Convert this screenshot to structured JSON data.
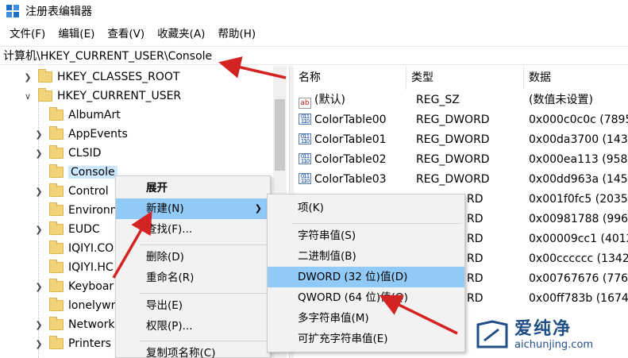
{
  "window": {
    "title": "注册表编辑器"
  },
  "menu": [
    "文件(F)",
    "编辑(E)",
    "查看(V)",
    "收藏夹(A)",
    "帮助(H)"
  ],
  "address": "计算机\\HKEY_CURRENT_USER\\Console",
  "tree": {
    "roots": [
      "HKEY_CLASSES_ROOT",
      "HKEY_CURRENT_USER"
    ],
    "children": [
      "AlbumArt",
      "AppEvents",
      "CLSID",
      "Console",
      "Control",
      "Environm",
      "EUDC",
      "IQIYI.CO",
      "IQIYI.HC",
      "Keyboar",
      "lonelywr",
      "Network",
      "Printers"
    ],
    "selected": "Console"
  },
  "list": {
    "columns": [
      "名称",
      "类型",
      "数据"
    ],
    "rows": [
      {
        "name": "(默认)",
        "type": "REG_SZ",
        "data": "(数值未设置)",
        "icon": "string-value-icon"
      },
      {
        "name": "ColorTable00",
        "type": "REG_DWORD",
        "data": "0x000c0c0c (7895",
        "icon": "binary-value-icon"
      },
      {
        "name": "ColorTable01",
        "type": "REG_DWORD",
        "data": "0x00da3700 (143",
        "icon": "binary-value-icon"
      },
      {
        "name": "ColorTable02",
        "type": "REG_DWORD",
        "data": "0x000ea113 (958",
        "icon": "binary-value-icon"
      },
      {
        "name": "ColorTable03",
        "type": "REG_DWORD",
        "data": "0x00dd963a (145",
        "icon": "binary-value-icon"
      },
      {
        "name": "",
        "type": "RD",
        "data": "0x001f0fc5 (2035",
        "icon": ""
      },
      {
        "name": "",
        "type": "RD",
        "data": "0x00981788 (996",
        "icon": ""
      },
      {
        "name": "",
        "type": "RD",
        "data": "0x00009cc1 (4012",
        "icon": ""
      },
      {
        "name": "",
        "type": "RD",
        "data": "0x00cccccc (1342",
        "icon": ""
      },
      {
        "name": "",
        "type": "RD",
        "data": "0x00767676 (776",
        "icon": ""
      },
      {
        "name": "",
        "type": "RD",
        "data": "0x00ff783b (1674",
        "icon": ""
      }
    ]
  },
  "context_menu": {
    "items": [
      "展开",
      "新建(N)",
      "查找(F)...",
      "删除(D)",
      "重命名(R)",
      "导出(E)",
      "权限(P)...",
      "复制项名称(C)"
    ],
    "highlighted": "新建(N)"
  },
  "submenu": {
    "items": [
      "项(K)",
      "字符串值(S)",
      "二进制值(B)",
      "DWORD (32 位)值(D)",
      "QWORD (64 位)值(Q)",
      "多字符串值(M)",
      "可扩充字符串值(E)"
    ],
    "highlighted": "DWORD (32 位)值(D)"
  },
  "watermark": {
    "brand": "爱纯净",
    "url": "aichunjing.com"
  },
  "colors": {
    "highlight": "#91c9f7",
    "selection": "#cce8ff",
    "arrow": "#d42323",
    "brand": "#1f4e86"
  }
}
